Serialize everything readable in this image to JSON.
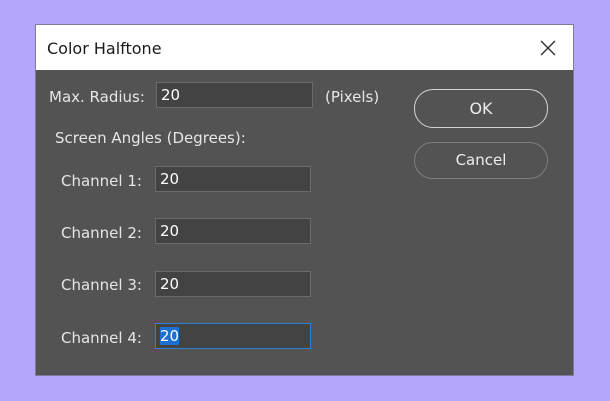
{
  "dialog": {
    "title": "Color Halftone",
    "close_icon": "close-icon"
  },
  "max_radius": {
    "label": "Max. Radius:",
    "value": "20",
    "unit": "(Pixels)"
  },
  "screen_angles": {
    "heading": "Screen Angles (Degrees):",
    "channels": [
      {
        "label": "Channel 1:",
        "value": "20"
      },
      {
        "label": "Channel 2:",
        "value": "20"
      },
      {
        "label": "Channel 3:",
        "value": "20"
      },
      {
        "label": "Channel 4:",
        "value": "20"
      }
    ]
  },
  "buttons": {
    "ok": "OK",
    "cancel": "Cancel"
  },
  "colors": {
    "background": "#b3a6fb",
    "dialog_body": "#535353",
    "field_bg": "#434343",
    "focus_border": "#2a7fd9",
    "selection": "#1e6fcf"
  }
}
